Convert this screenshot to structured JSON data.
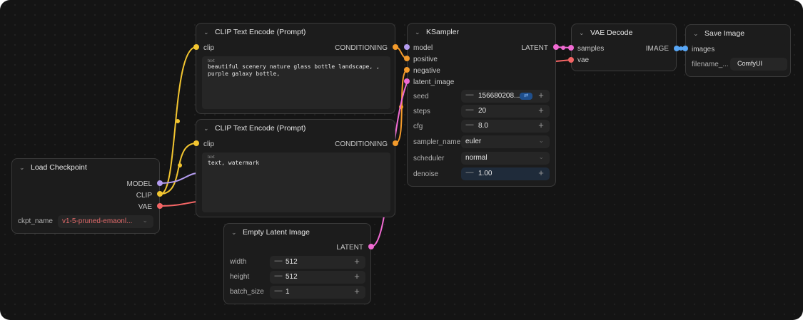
{
  "colors": {
    "background": "#141414",
    "node": "#1c1c1c",
    "clip": "#f2c530",
    "conditioning": "#f39a2b",
    "model": "#b49cf0",
    "vae": "#f46565",
    "latent": "#f06ad2",
    "image": "#58a6f5"
  },
  "load_checkpoint": {
    "title": "Load Checkpoint",
    "outputs": {
      "model": "MODEL",
      "clip": "CLIP",
      "vae": "VAE"
    },
    "ckpt_label": "ckpt_name",
    "ckpt_value": "v1-5-pruned-emaonl..."
  },
  "clip_pos": {
    "title": "CLIP Text Encode (Prompt)",
    "input_clip": "clip",
    "output": "CONDITIONING",
    "text_caption": "text",
    "text": "beautiful scenery nature glass bottle landscape, , purple galaxy bottle,"
  },
  "clip_neg": {
    "title": "CLIP Text Encode (Prompt)",
    "input_clip": "clip",
    "output": "CONDITIONING",
    "text_caption": "text",
    "text": "text, watermark"
  },
  "empty_latent": {
    "title": "Empty Latent Image",
    "output": "LATENT",
    "width_label": "width",
    "width": "512",
    "height_label": "height",
    "height": "512",
    "batch_label": "batch_size",
    "batch": "1"
  },
  "ksampler": {
    "title": "KSampler",
    "inputs": {
      "model": "model",
      "positive": "positive",
      "negative": "negative",
      "latent_image": "latent_image"
    },
    "output": "LATENT",
    "seed_label": "seed",
    "seed": "156680208...",
    "steps_label": "steps",
    "steps": "20",
    "cfg_label": "cfg",
    "cfg": "8.0",
    "sampler_label": "sampler_name",
    "sampler": "euler",
    "scheduler_label": "scheduler",
    "scheduler": "normal",
    "denoise_label": "denoise",
    "denoise": "1.00"
  },
  "vae_decode": {
    "title": "VAE Decode",
    "input_samples": "samples",
    "input_vae": "vae",
    "output": "IMAGE"
  },
  "save_image": {
    "title": "Save Image",
    "input_images": "images",
    "filename_label": "filename_...",
    "filename_value": "ComfyUI"
  },
  "icons": {
    "collapse": "chevron-down-icon",
    "seed_control": "shuffle-icon"
  }
}
